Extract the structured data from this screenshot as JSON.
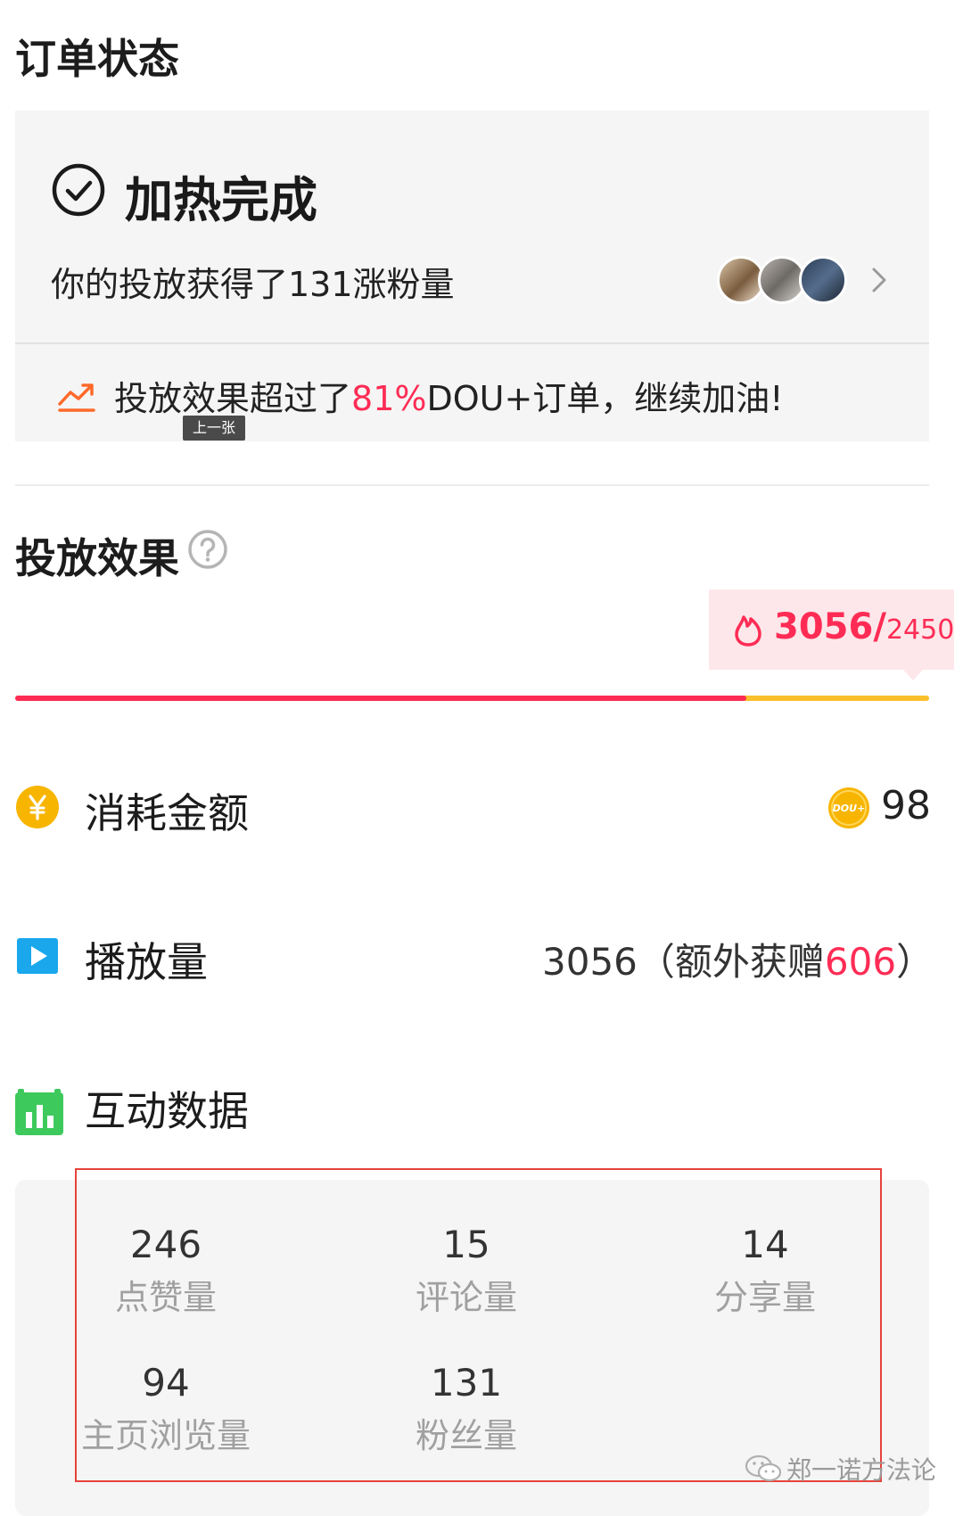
{
  "order_status": {
    "title": "订单状态",
    "status_title": "加热完成",
    "subtitle": "你的投放获得了131涨粉量",
    "tip_prefix": "投放效果超过了",
    "tip_percent": "81%",
    "tip_suffix": "DOU+订单，继续加油!",
    "tooltip": "上一张"
  },
  "effect": {
    "title": "投放效果",
    "badge_value": "3056/",
    "badge_target": "2450",
    "progress_fraction": 0.8
  },
  "rows": {
    "spend_label": "消耗金额",
    "spend_value": "98",
    "coin_text": "DOU+",
    "play_label": "播放量",
    "play_value_prefix": "3056（额外获赠",
    "play_bonus": "606",
    "play_value_suffix": "）",
    "interaction_label": "互动数据"
  },
  "stats": [
    {
      "value": "246",
      "label": "点赞量"
    },
    {
      "value": "15",
      "label": "评论量"
    },
    {
      "value": "14",
      "label": "分享量"
    },
    {
      "value": "94",
      "label": "主页浏览量"
    },
    {
      "value": "131",
      "label": "粉丝量"
    }
  ],
  "watermark": "郑一诺方法论",
  "colors": {
    "accent": "#fe2c55",
    "progress_rest": "#fbbf2b",
    "coin": "#f7b500",
    "play_icon": "#1aa7ec",
    "chart_icon": "#3ec95c"
  }
}
